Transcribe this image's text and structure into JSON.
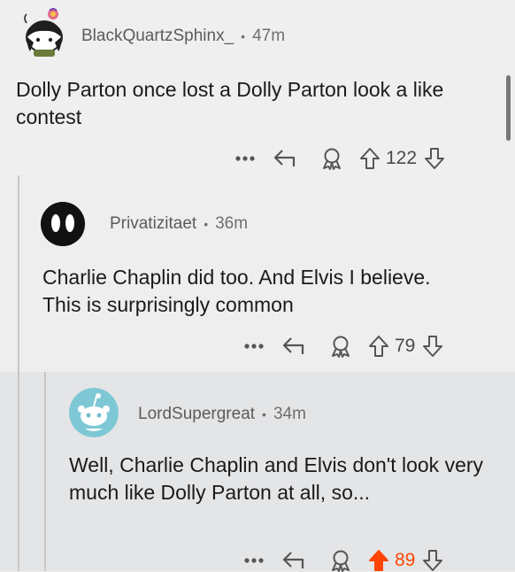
{
  "comments": [
    {
      "username": "BlackQuartzSphinx_",
      "separator": "•",
      "age": "47m",
      "text": "Dolly Parton once lost a Dolly Parton look a like contest",
      "more": "•••",
      "votes": "122",
      "upvoted": false
    },
    {
      "username": "Privatizitaet",
      "separator": "•",
      "age": "36m",
      "text": "Charlie Chaplin did too. And Elvis I believe. This is surprisingly common",
      "more": "•••",
      "votes": "79",
      "upvoted": false
    },
    {
      "username": "LordSupergreat",
      "separator": "•",
      "age": "34m",
      "text": "Well, Charlie Chaplin and Elvis don't look very much like Dolly Parton at all, so...",
      "more": "•••",
      "votes": "89",
      "upvoted": true
    }
  ],
  "colors": {
    "upvote_active": "#ff4500",
    "text": "#1a1a1a",
    "meta": "#6e6e6e",
    "highlight_background": "#e4e5e7"
  },
  "icons": [
    "more-icon",
    "reply-icon",
    "award-icon",
    "upvote-icon",
    "downvote-icon"
  ]
}
